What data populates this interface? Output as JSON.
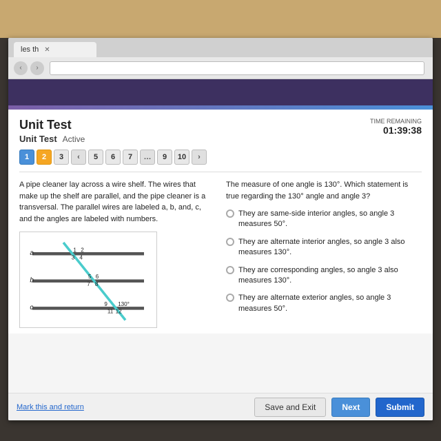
{
  "page": {
    "title": "Unit Test",
    "subtitle": "Unit Test",
    "status": "Active",
    "time_label": "TIME REMAINING",
    "time_value": "01:39:38"
  },
  "navigation": {
    "tab_label": "les th",
    "questions": [
      {
        "num": "1",
        "state": "answered"
      },
      {
        "num": "2",
        "state": "active"
      },
      {
        "num": "3",
        "state": "default"
      },
      {
        "num": "5",
        "state": "default"
      },
      {
        "num": "6",
        "state": "default"
      },
      {
        "num": "7",
        "state": "default"
      },
      {
        "num": "9",
        "state": "default"
      },
      {
        "num": "10",
        "state": "default"
      }
    ]
  },
  "left_question": {
    "text": "A pipe cleaner lay across a wire shelf. The wires that make up the shelf are parallel, and the pipe cleaner is a transversal. The parallel wires are labeled a, b, and, c, and the angles are labeled with numbers."
  },
  "right_question": {
    "text": "The measure of one angle is 130°. Which statement is true regarding the 130° angle and angle 3?",
    "choices": [
      {
        "label": "They are same-side interior angles, so angle 3 measures 50°."
      },
      {
        "label": "They are alternate interior angles, so angle 3 also measures 130°."
      },
      {
        "label": "They are corresponding angles, so angle 3 also measures 130°."
      },
      {
        "label": "They are alternate exterior angles, so angle 3 measures 50°."
      }
    ]
  },
  "footer": {
    "mark_link": "Mark this and return",
    "save_exit": "Save and Exit",
    "next": "Next",
    "submit": "Submit"
  }
}
